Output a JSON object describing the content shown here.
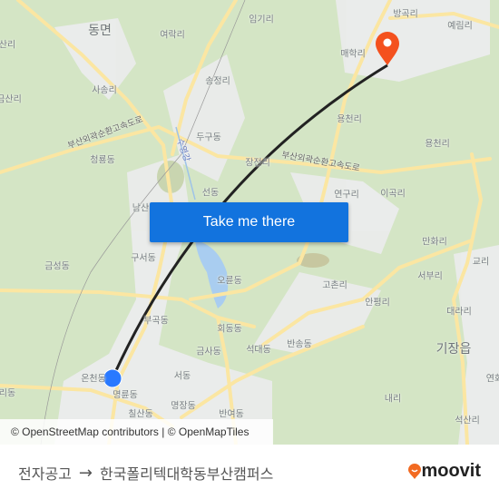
{
  "map": {
    "labels": [
      "동면",
      "여락리",
      "임기리",
      "방곡리",
      "예림리",
      "매학리",
      "산리",
      "사송리",
      "송정리",
      "금산리",
      "두구동",
      "용천리",
      "용천리",
      "장전리",
      "청룡동",
      "선동",
      "연구리",
      "이곡리",
      "남산",
      "구서동",
      "금성동",
      "오륜동",
      "만화리",
      "교리",
      "서부리",
      "고촌리",
      "안평리",
      "대라리",
      "부곡동",
      "회동동",
      "반송동",
      "석대동",
      "기장읍",
      "금사동",
      "온천동",
      "서동",
      "연화",
      "명륜동",
      "내리",
      "명장동",
      "칠산동",
      "반여동",
      "석산리",
      "리동"
    ],
    "road_labels": [
      "부산외곽순환고속도로",
      "부산외곽순환고속도로",
      "수영강"
    ],
    "origin_marker_color": "#2979ff",
    "destination_marker_color": "#f4511e",
    "route_line_color": "#222222"
  },
  "cta": {
    "label": "Take me there",
    "color": "#1273de"
  },
  "attribution": "© OpenStreetMap contributors | © OpenMapTiles",
  "footer": {
    "origin": "전자공고",
    "arrow_icon": "arrow-right-icon",
    "destination": "한국폴리텍대학동부산캠퍼스",
    "brand": "moovit",
    "brand_color": "#f26a21"
  }
}
